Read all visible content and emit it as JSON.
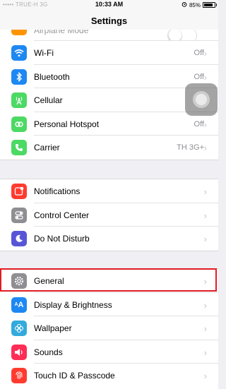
{
  "status_bar": {
    "carrier": "••••• TRUE-H  3G",
    "time": "10:33 AM",
    "alarm_icon": "alarm-clock-icon",
    "battery_percent": "85%",
    "battery_level": 0.85
  },
  "nav": {
    "title": "Settings"
  },
  "groups": [
    {
      "items": [
        {
          "label": "Airplane Mode",
          "icon": "airplane-icon",
          "color": "#ff9500",
          "toggle_on": false
        },
        {
          "label": "Wi-Fi",
          "icon": "wifi-icon",
          "color": "#1e88f2",
          "value": "Off"
        },
        {
          "label": "Bluetooth",
          "icon": "bluetooth-icon",
          "color": "#1e88f2",
          "value": "Off"
        },
        {
          "label": "Cellular",
          "icon": "antenna-icon",
          "color": "#4cd964",
          "value": ""
        },
        {
          "label": "Personal Hotspot",
          "icon": "hotspot-icon",
          "color": "#4cd964",
          "value": "Off"
        },
        {
          "label": "Carrier",
          "icon": "phone-icon",
          "color": "#4cd964",
          "value": "TH 3G+"
        }
      ]
    },
    {
      "items": [
        {
          "label": "Notifications",
          "icon": "notifications-icon",
          "color": "#ff3b30"
        },
        {
          "label": "Control Center",
          "icon": "toggles-icon",
          "color": "#8e8e93"
        },
        {
          "label": "Do Not Disturb",
          "icon": "moon-icon",
          "color": "#5856d6"
        }
      ]
    },
    {
      "items": [
        {
          "label": "General",
          "icon": "gear-icon",
          "color": "#8e8e93"
        },
        {
          "label": "Display & Brightness",
          "icon": "text-size-icon",
          "color": "#1e88f2"
        },
        {
          "label": "Wallpaper",
          "icon": "flower-icon",
          "color": "#34aadc"
        },
        {
          "label": "Sounds",
          "icon": "speaker-icon",
          "color": "#ff2d55"
        },
        {
          "label": "Touch ID & Passcode",
          "icon": "fingerprint-icon",
          "color": "#ff3b30"
        }
      ]
    }
  ],
  "highlight_color": "#e01c24"
}
